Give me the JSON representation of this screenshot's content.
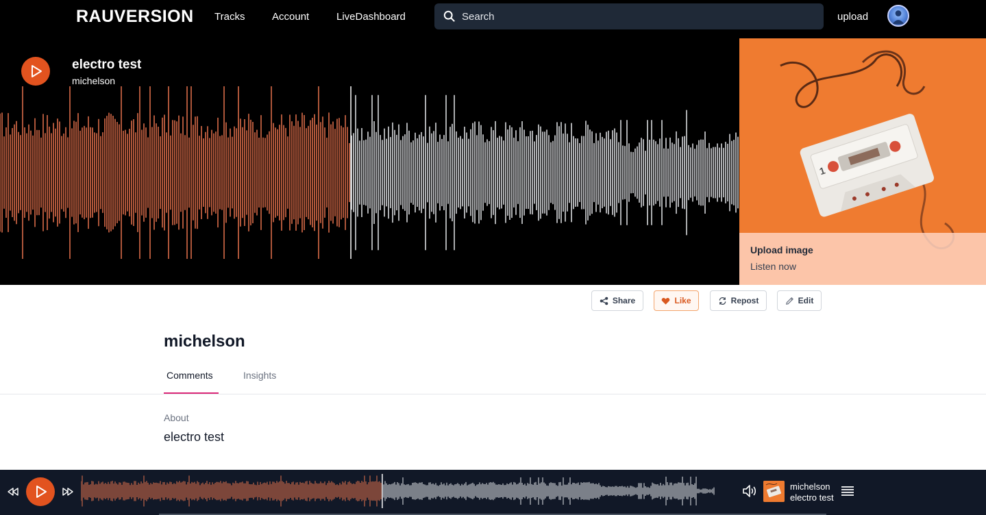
{
  "nav": {
    "logo": "RAUVERSION",
    "links": [
      "Tracks",
      "Account",
      "LiveDashboard"
    ],
    "search_placeholder": "Search",
    "upload_label": "upload"
  },
  "hero": {
    "title": "electro test",
    "artist": "michelson",
    "played_fraction": 0.475,
    "cover": {
      "upload_label": "Upload image",
      "listen_label": "Listen now"
    }
  },
  "actions": {
    "share": "Share",
    "like": "Like",
    "repost": "Repost",
    "edit": "Edit"
  },
  "profile": {
    "name": "michelson",
    "tabs": [
      "Comments",
      "Insights"
    ],
    "active_tab": "Comments",
    "about_label": "About",
    "about_text": "electro test"
  },
  "player": {
    "artist": "michelson",
    "track": "electro test",
    "played_fraction": 0.475
  },
  "colors": {
    "accent": "#e2531f",
    "played_wave": "#e8734e",
    "unplayed_wave": "#e5e7eb",
    "tab_underline": "#db2777"
  },
  "icons": [
    "search-icon",
    "play-icon",
    "share-icon",
    "heart-icon",
    "repost-icon",
    "pencil-icon",
    "rewind-icon",
    "fast-forward-icon",
    "volume-icon",
    "queue-list-icon"
  ]
}
